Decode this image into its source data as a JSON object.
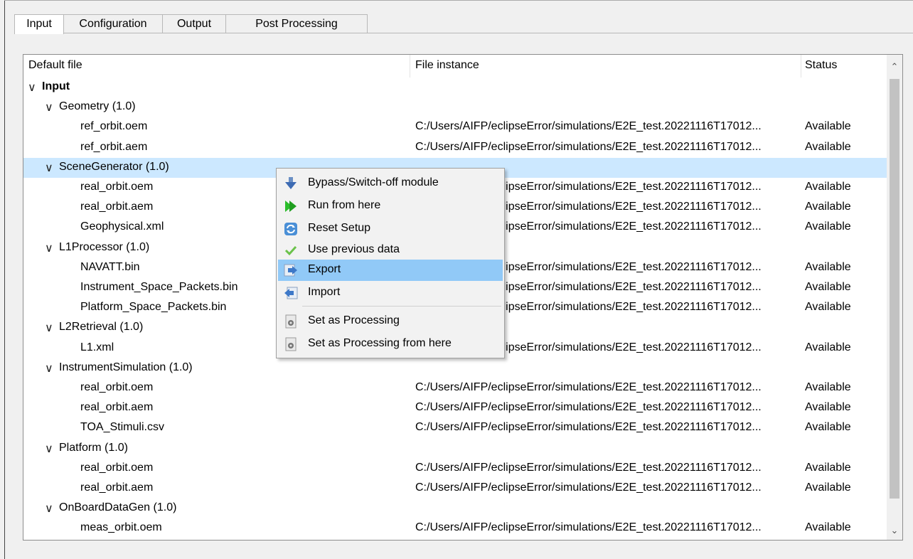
{
  "tabs": [
    {
      "label": "Input"
    },
    {
      "label": "Configuration"
    },
    {
      "label": "Output"
    },
    {
      "label": "Post Processing"
    }
  ],
  "tree": {
    "headers": {
      "default_file": "Default file",
      "file_instance": "File instance",
      "status": "Status"
    },
    "rows": [
      {
        "label": "Input",
        "level": 0,
        "expanded": true,
        "instance": "",
        "status": ""
      },
      {
        "label": "Geometry (1.0)",
        "level": 1,
        "expanded": true,
        "instance": "",
        "status": ""
      },
      {
        "label": "ref_orbit.oem",
        "level": 2,
        "instance": "C:/Users/AIFP/eclipseError/simulations/E2E_test.20221116T17012...",
        "status": "Available"
      },
      {
        "label": "ref_orbit.aem",
        "level": 2,
        "instance": "C:/Users/AIFP/eclipseError/simulations/E2E_test.20221116T17012...",
        "status": "Available"
      },
      {
        "label": "SceneGenerator (1.0)",
        "level": 1,
        "expanded": true,
        "selected": true,
        "instance": "",
        "status": ""
      },
      {
        "label": "real_orbit.oem",
        "level": 2,
        "instance": "C:/Users/AIFP/eclipseError/simulations/E2E_test.20221116T17012...",
        "status": "Available"
      },
      {
        "label": "real_orbit.aem",
        "level": 2,
        "instance": "C:/Users/AIFP/eclipseError/simulations/E2E_test.20221116T17012...",
        "status": "Available"
      },
      {
        "label": "Geophysical.xml",
        "level": 2,
        "instance": "C:/Users/AIFP/eclipseError/simulations/E2E_test.20221116T17012...",
        "status": "Available"
      },
      {
        "label": "L1Processor (1.0)",
        "level": 1,
        "expanded": true,
        "instance": "",
        "status": ""
      },
      {
        "label": "NAVATT.bin",
        "level": 2,
        "instance": "C:/Users/AIFP/eclipseError/simulations/E2E_test.20221116T17012...",
        "status": "Available"
      },
      {
        "label": "Instrument_Space_Packets.bin",
        "level": 2,
        "instance": "C:/Users/AIFP/eclipseError/simulations/E2E_test.20221116T17012...",
        "status": "Available"
      },
      {
        "label": "Platform_Space_Packets.bin",
        "level": 2,
        "instance": "C:/Users/AIFP/eclipseError/simulations/E2E_test.20221116T17012...",
        "status": "Available"
      },
      {
        "label": "L2Retrieval (1.0)",
        "level": 1,
        "expanded": true,
        "instance": "",
        "status": ""
      },
      {
        "label": "L1.xml",
        "level": 2,
        "instance": "C:/Users/AIFP/eclipseError/simulations/E2E_test.20221116T17012...",
        "status": "Available"
      },
      {
        "label": "InstrumentSimulation (1.0)",
        "level": 1,
        "expanded": true,
        "instance": "",
        "status": ""
      },
      {
        "label": "real_orbit.oem",
        "level": 2,
        "instance": "C:/Users/AIFP/eclipseError/simulations/E2E_test.20221116T17012...",
        "status": "Available"
      },
      {
        "label": "real_orbit.aem",
        "level": 2,
        "instance": "C:/Users/AIFP/eclipseError/simulations/E2E_test.20221116T17012...",
        "status": "Available"
      },
      {
        "label": "TOA_Stimuli.csv",
        "level": 2,
        "instance": "C:/Users/AIFP/eclipseError/simulations/E2E_test.20221116T17012...",
        "status": "Available"
      },
      {
        "label": "Platform (1.0)",
        "level": 1,
        "expanded": true,
        "instance": "",
        "status": ""
      },
      {
        "label": "real_orbit.oem",
        "level": 2,
        "instance": "C:/Users/AIFP/eclipseError/simulations/E2E_test.20221116T17012...",
        "status": "Available"
      },
      {
        "label": "real_orbit.aem",
        "level": 2,
        "instance": "C:/Users/AIFP/eclipseError/simulations/E2E_test.20221116T17012...",
        "status": "Available"
      },
      {
        "label": "OnBoardDataGen (1.0)",
        "level": 1,
        "expanded": true,
        "instance": "",
        "status": ""
      },
      {
        "label": "meas_orbit.oem",
        "level": 2,
        "instance": "C:/Users/AIFP/eclipseError/simulations/E2E_test.20221116T17012...",
        "status": "Available"
      }
    ]
  },
  "context_menu": {
    "items": [
      {
        "label": "Bypass/Switch-off module",
        "icon": "bypass-icon"
      },
      {
        "label": "Run from here",
        "icon": "run-icon"
      },
      {
        "label": "Reset Setup",
        "icon": "reset-icon"
      },
      {
        "label": "Use previous data",
        "icon": "checkmark-icon"
      },
      {
        "label": "Export",
        "icon": "export-icon",
        "highlighted": true
      },
      {
        "label": "Import",
        "icon": "import-icon"
      },
      {
        "label": "Set as Processing",
        "icon": "processing-icon"
      },
      {
        "label": "Set as Processing from here",
        "icon": "processing-from-here-icon"
      }
    ]
  },
  "colors": {
    "selection": "#cce8ff",
    "menu_highlight": "#91c9f7",
    "run_green": "#2bbd2b",
    "check_green": "#6ac24a"
  }
}
